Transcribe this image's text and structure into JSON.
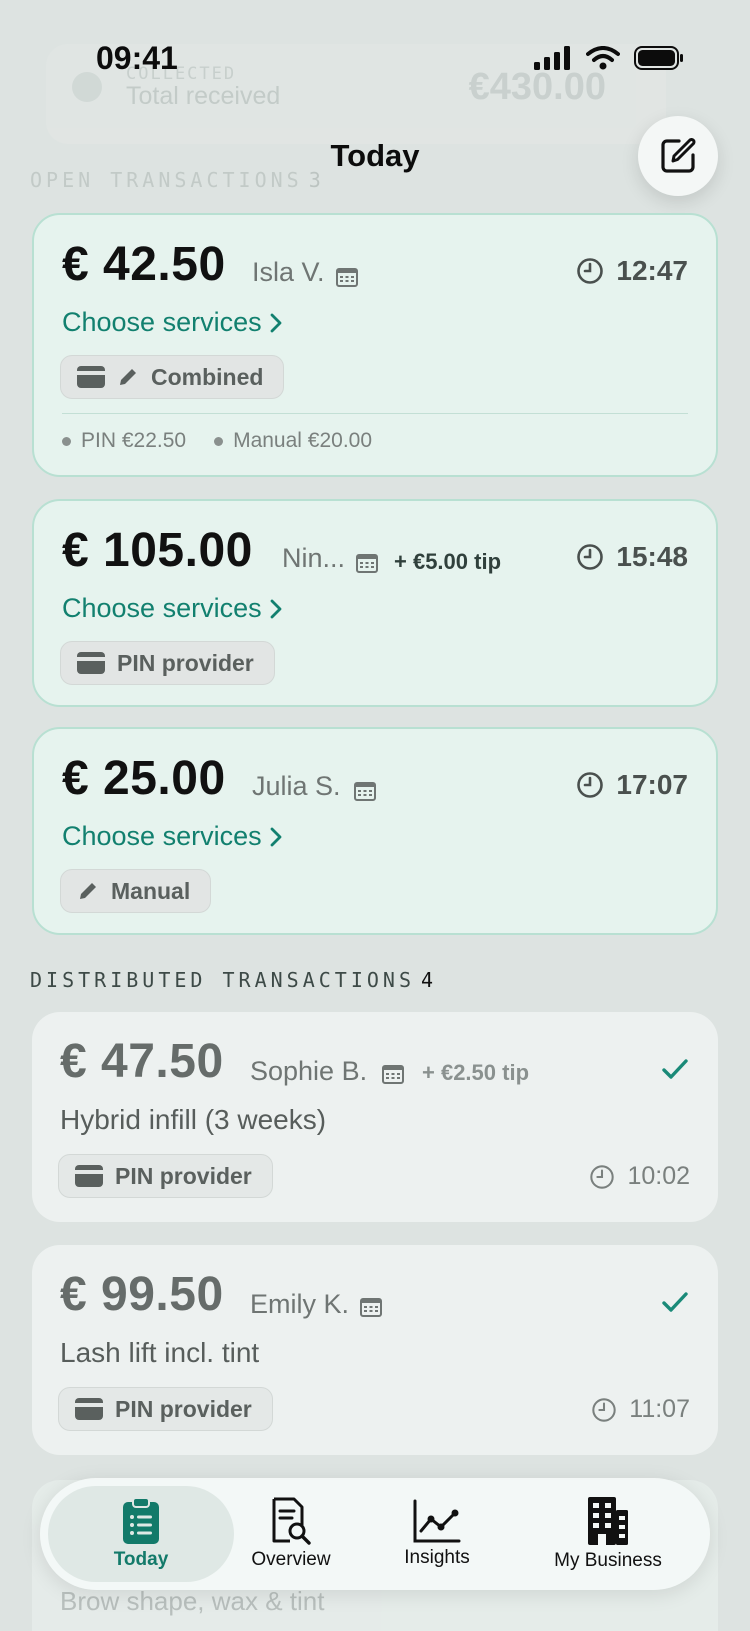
{
  "status_bar": {
    "time": "09:41"
  },
  "background_card": {
    "label": "COLLECTED",
    "title": "Total received",
    "amount": "€430.00"
  },
  "header": {
    "title": "Today"
  },
  "open_section": {
    "label": "OPEN TRANSACTIONS",
    "count": "3"
  },
  "open_cards": [
    {
      "amount": "€ 42.50",
      "client": "Isla V.",
      "tip": "",
      "time": "12:47",
      "choose_label": "Choose services",
      "method": "Combined",
      "splits": [
        "PIN €22.50",
        "Manual €20.00"
      ]
    },
    {
      "amount": "€ 105.00",
      "client": "Nin...",
      "tip": "+ €5.00 tip",
      "time": "15:48",
      "choose_label": "Choose services",
      "method": "PIN provider"
    },
    {
      "amount": "€ 25.00",
      "client": "Julia S.",
      "tip": "",
      "time": "17:07",
      "choose_label": "Choose services",
      "method": "Manual"
    }
  ],
  "distributed_section": {
    "label": "DISTRIBUTED TRANSACTIONS",
    "count": "4"
  },
  "distributed_cards": [
    {
      "amount": "€ 47.50",
      "client": "Sophie B.",
      "tip": "+ €2.50 tip",
      "service": "Hybrid infill (3 weeks)",
      "method": "PIN provider",
      "time": "10:02"
    },
    {
      "amount": "€ 99.50",
      "client": "Emily K.",
      "tip": "",
      "service": "Lash lift incl. tint",
      "method": "PIN provider",
      "time": "11:07"
    }
  ],
  "peek_card": {
    "service": "Brow shape, wax & tint"
  },
  "nav": {
    "items": [
      {
        "label": "Today",
        "icon": "clipboard-list-icon",
        "active": true
      },
      {
        "label": "Overview",
        "icon": "document-search-icon",
        "active": false
      },
      {
        "label": "Insights",
        "icon": "line-chart-icon",
        "active": false
      },
      {
        "label": "My Business",
        "icon": "building-icon",
        "active": false
      }
    ]
  },
  "colors": {
    "accent": "#12806f",
    "open_card_bg": "#e6f3ee",
    "open_card_border": "#b8e0d2",
    "done_card_bg": "#edf1f0"
  }
}
